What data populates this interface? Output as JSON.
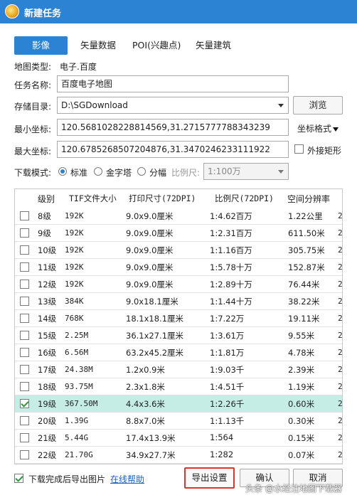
{
  "window": {
    "title": "新建任务"
  },
  "tabs": [
    {
      "label": "影像",
      "active": true
    },
    {
      "label": "矢量数据",
      "active": false
    },
    {
      "label": "POI(兴趣点)",
      "active": false
    },
    {
      "label": "矢量建筑",
      "active": false
    }
  ],
  "map_type": {
    "label": "地图类型:",
    "value": "电子.百度"
  },
  "task_name": {
    "label": "任务名称:",
    "value": "百度电子地图"
  },
  "storage": {
    "label": "存储目录:",
    "value": "D:\\SGDownload",
    "browse_label": "浏览"
  },
  "min_coord": {
    "label": "最小坐标:",
    "value": "120.5681028228814569,31.2715777788343239",
    "format_label": "坐标格式"
  },
  "max_coord": {
    "label": "最大坐标:",
    "value": "120.6785268507204876,31.3470246233111922",
    "outer_rect_label": "外接矩形",
    "outer_rect_checked": false
  },
  "download_mode": {
    "label": "下载模式:",
    "options": [
      {
        "label": "标准",
        "checked": true
      },
      {
        "label": "金字塔",
        "checked": false
      },
      {
        "label": "分幅",
        "checked": false
      }
    ],
    "scale_label": "比例尺:",
    "scale_value": "1:100万"
  },
  "table": {
    "headers": [
      "级别",
      "TIF文件大小",
      "打印尺寸(72DPI)",
      "比例尺(72DPI)",
      "空间分辨率"
    ],
    "rows": [
      {
        "checked": false,
        "selected": false,
        "level": "8级",
        "size": "192K",
        "print": "9.0x9.0厘米",
        "scale": "1:4.62百万",
        "res": "1.22公里",
        "extra": "2"
      },
      {
        "checked": false,
        "selected": false,
        "level": "9级",
        "size": "192K",
        "print": "9.0x9.0厘米",
        "scale": "1:2.31百万",
        "res": "611.50米",
        "extra": "2"
      },
      {
        "checked": false,
        "selected": false,
        "level": "10级",
        "size": "192K",
        "print": "9.0x9.0厘米",
        "scale": "1:1.16百万",
        "res": "305.75米",
        "extra": "2"
      },
      {
        "checked": false,
        "selected": false,
        "level": "11级",
        "size": "192K",
        "print": "9.0x9.0厘米",
        "scale": "1:5.78十万",
        "res": "152.87米",
        "extra": "2"
      },
      {
        "checked": false,
        "selected": false,
        "level": "12级",
        "size": "192K",
        "print": "9.0x9.0厘米",
        "scale": "1:2.89十万",
        "res": "76.44米",
        "extra": "2"
      },
      {
        "checked": false,
        "selected": false,
        "level": "13级",
        "size": "384K",
        "print": "9.0x18.1厘米",
        "scale": "1:1.44十万",
        "res": "38.22米",
        "extra": "2"
      },
      {
        "checked": false,
        "selected": false,
        "level": "14级",
        "size": "768K",
        "print": "18.1x18.1厘米",
        "scale": "1:7.22万",
        "res": "19.11米",
        "extra": "2"
      },
      {
        "checked": false,
        "selected": false,
        "level": "15级",
        "size": "2.25M",
        "print": "36.1x27.1厘米",
        "scale": "1:3.61万",
        "res": "9.55米",
        "extra": "2"
      },
      {
        "checked": false,
        "selected": false,
        "level": "16级",
        "size": "6.56M",
        "print": "63.2x45.2厘米",
        "scale": "1:1.81万",
        "res": "4.78米",
        "extra": "2"
      },
      {
        "checked": false,
        "selected": false,
        "level": "17级",
        "size": "24.38M",
        "print": "1.2x0.9米",
        "scale": "1:9.03千",
        "res": "2.39米",
        "extra": "2"
      },
      {
        "checked": false,
        "selected": false,
        "level": "18级",
        "size": "93.75M",
        "print": "2.3x1.8米",
        "scale": "1:4.51千",
        "res": "1.19米",
        "extra": "2"
      },
      {
        "checked": true,
        "selected": true,
        "level": "19级",
        "size": "367.50M",
        "print": "4.4x3.6米",
        "scale": "1:2.26千",
        "res": "0.60米",
        "extra": "2"
      },
      {
        "checked": false,
        "selected": false,
        "level": "20级",
        "size": "1.39G",
        "print": "8.8x7.0米",
        "scale": "1:1.13千",
        "res": "0.30米",
        "extra": "2"
      },
      {
        "checked": false,
        "selected": false,
        "level": "21级",
        "size": "5.44G",
        "print": "17.4x13.9米",
        "scale": "1:564",
        "res": "0.15米",
        "extra": "2"
      },
      {
        "checked": false,
        "selected": false,
        "level": "22级",
        "size": "21.70G",
        "print": "34.9x27.7米",
        "scale": "1:282",
        "res": "0.07米",
        "extra": "2"
      }
    ]
  },
  "footer": {
    "export_after_label": "下载完成后导出图片",
    "export_after_checked": true,
    "help_label": "在线帮助",
    "export_settings_label": "导出设置",
    "ok_label": "确认",
    "cancel_label": "取消"
  },
  "watermark": "头条 @水经注地图下载器",
  "colors": {
    "accent": "#2d83d3",
    "selected_row": "#c5ede6",
    "highlight_border": "#e0332a"
  }
}
